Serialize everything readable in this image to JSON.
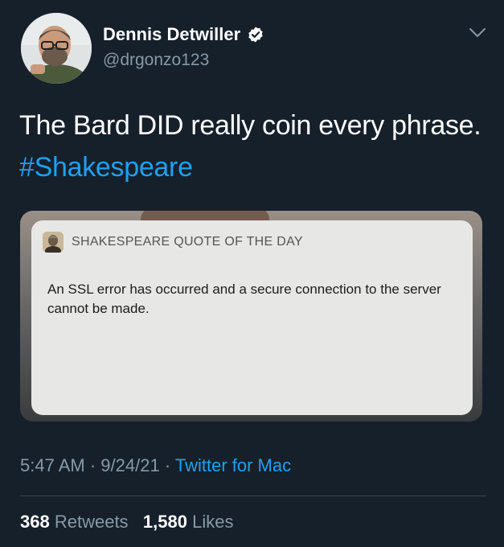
{
  "author": {
    "display_name": "Dennis Detwiller",
    "handle": "@drgonzo123",
    "verified": true
  },
  "tweet": {
    "text": "The Bard DID really coin every phrase.",
    "hashtag": "#Shakespeare"
  },
  "media": {
    "notification": {
      "app_name": "SHAKESPEARE QUOTE OF THE DAY",
      "message": "An SSL error has occurred and a secure connection to the server cannot be made."
    }
  },
  "meta": {
    "time": "5:47 AM",
    "date": "9/24/21",
    "source": "Twitter for Mac"
  },
  "stats": {
    "retweets_count": "368",
    "retweets_label": "Retweets",
    "likes_count": "1,580",
    "likes_label": "Likes"
  },
  "colors": {
    "background": "#15202b",
    "link": "#1da1f2",
    "secondary_text": "#8899a6"
  },
  "icons": {
    "verified": "verified-badge-icon",
    "more": "chevron-down-icon"
  }
}
